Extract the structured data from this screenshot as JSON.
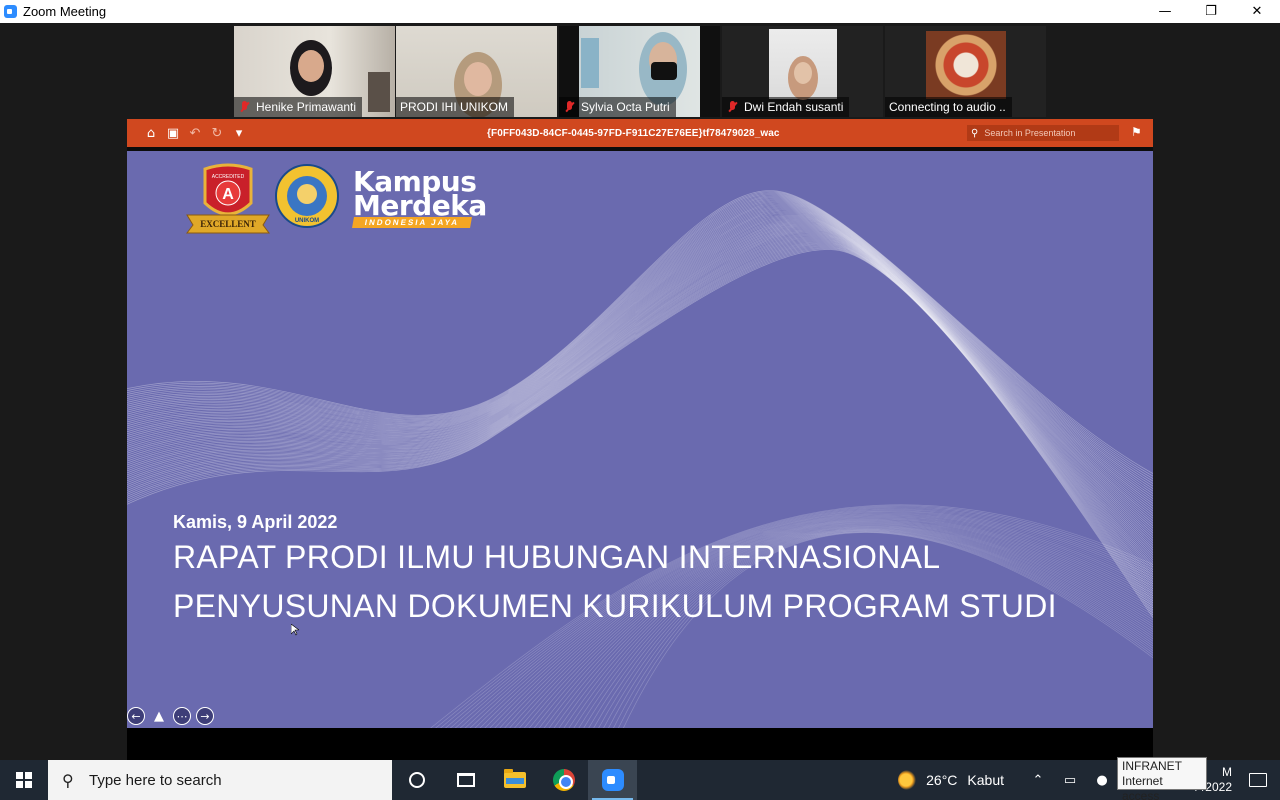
{
  "window": {
    "title": "Zoom Meeting",
    "controls": {
      "minimize": "—",
      "restore": "❐",
      "close": "✕"
    }
  },
  "participants": [
    {
      "name": "Henike Primawanti",
      "muted": true,
      "active": false
    },
    {
      "name": "PRODI IHI UNIKOM",
      "muted": false,
      "active": true
    },
    {
      "name": "Sylvia Octa Putri",
      "muted": true,
      "active": false
    },
    {
      "name": "Dwi Endah susanti",
      "muted": true,
      "active": false
    },
    {
      "name": "Connecting to audio ..",
      "muted": false,
      "active": false
    }
  ],
  "presentation": {
    "toolbar": {
      "home_icon": "⌂",
      "save_icon": "▣",
      "undo_icon": "↶",
      "redo_icon": "↻",
      "more_icon": "▾",
      "document_title": "{F0FF043D-84CF-0445-97FD-F911C27E76EE}tf78479028_wac",
      "search_placeholder": "Search in Presentation",
      "search_icon": "⚲",
      "share_icon": "⚑"
    },
    "slide": {
      "badge_text_top": "ACCREDITED",
      "badge_letter": "A",
      "badge_ribbon": "EXCELLENT",
      "seal_text": "UNIKOM",
      "logo_line1": "Kampus",
      "logo_line2": "Merdeka",
      "logo_tagline": "INDONESIA JAYA",
      "date": "Kamis, 9 April 2022",
      "title_line1": "RAPAT PRODI ILMU HUBUNGAN INTERNASIONAL",
      "title_line2": "PENYUSUNAN DOKUMEN KURIKULUM PROGRAM STUDI",
      "background_color": "#6a6aaf"
    },
    "nav": {
      "prev": "←",
      "pen": "▲",
      "more": "⋯",
      "next": "→"
    }
  },
  "taskbar": {
    "search_placeholder": "Type here to search",
    "apps": [
      "cortana",
      "task-view",
      "file-explorer",
      "chrome",
      "zoom"
    ],
    "weather": {
      "temp": "26°C",
      "condition": "Kabut"
    },
    "clock_time_fragment": "M",
    "clock_date_fragment": "/ /2022"
  },
  "tooltip": {
    "line1": "INFRANET",
    "line2": "Internet access"
  },
  "colors": {
    "ppt_accent": "#d0481f",
    "active_speaker": "#7fd13b",
    "taskbar": "#1f2833",
    "slide_bg": "#6a6aaf"
  }
}
